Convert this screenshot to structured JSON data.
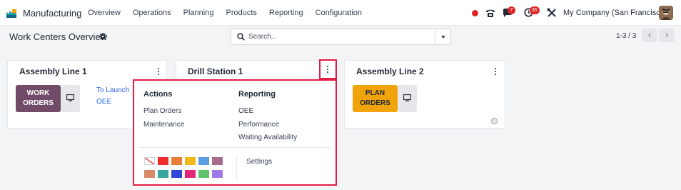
{
  "navbar": {
    "app_name": "Manufacturing",
    "menu": [
      "Overview",
      "Operations",
      "Planning",
      "Products",
      "Reporting",
      "Configuration"
    ],
    "chat_badge": "7",
    "activity_badge": "35",
    "company": "My Company (San Francisco)"
  },
  "control_panel": {
    "title": "Work Centers Overview",
    "search_placeholder": "Search...",
    "pager": "1-3 / 3",
    "prev": "‹",
    "next": "›"
  },
  "cards": [
    {
      "name": "Assembly Line 1",
      "button": [
        "WORK",
        "ORDERS"
      ],
      "links": [
        "To Launch",
        "OEE"
      ]
    },
    {
      "name": "Drill Station 1"
    },
    {
      "name": "Assembly Line 2",
      "button": [
        "PLAN",
        "ORDERS"
      ]
    }
  ],
  "dropdown": {
    "actions_heading": "Actions",
    "actions": [
      "Plan Orders",
      "Maintenance"
    ],
    "reporting_heading": "Reporting",
    "reporting": [
      "OEE",
      "Performance",
      "Waiting Availability"
    ],
    "settings": "Settings",
    "colors": [
      "#f04b4b",
      "#f4a460",
      "#eebc2a",
      "#6cc1ed",
      "#814968",
      "#eb7e7f",
      "#2c8397",
      "#475577",
      "#d6145f",
      "#30c381",
      "#9365b8"
    ],
    "color_rows": [
      [
        "none",
        "#ef2b2b",
        "#e87d37",
        "#efb918",
        "#5b9ee4",
        "#a66a8a"
      ],
      [
        "#d88b6a",
        "#38a6a1",
        "#3347d6",
        "#e3287a",
        "#5fc56b",
        "#a07ae4"
      ]
    ]
  },
  "colors": {
    "work_orders_btn": "#714B67",
    "plan_orders_btn": "#F0A30A",
    "highlight": "#E11D48"
  }
}
